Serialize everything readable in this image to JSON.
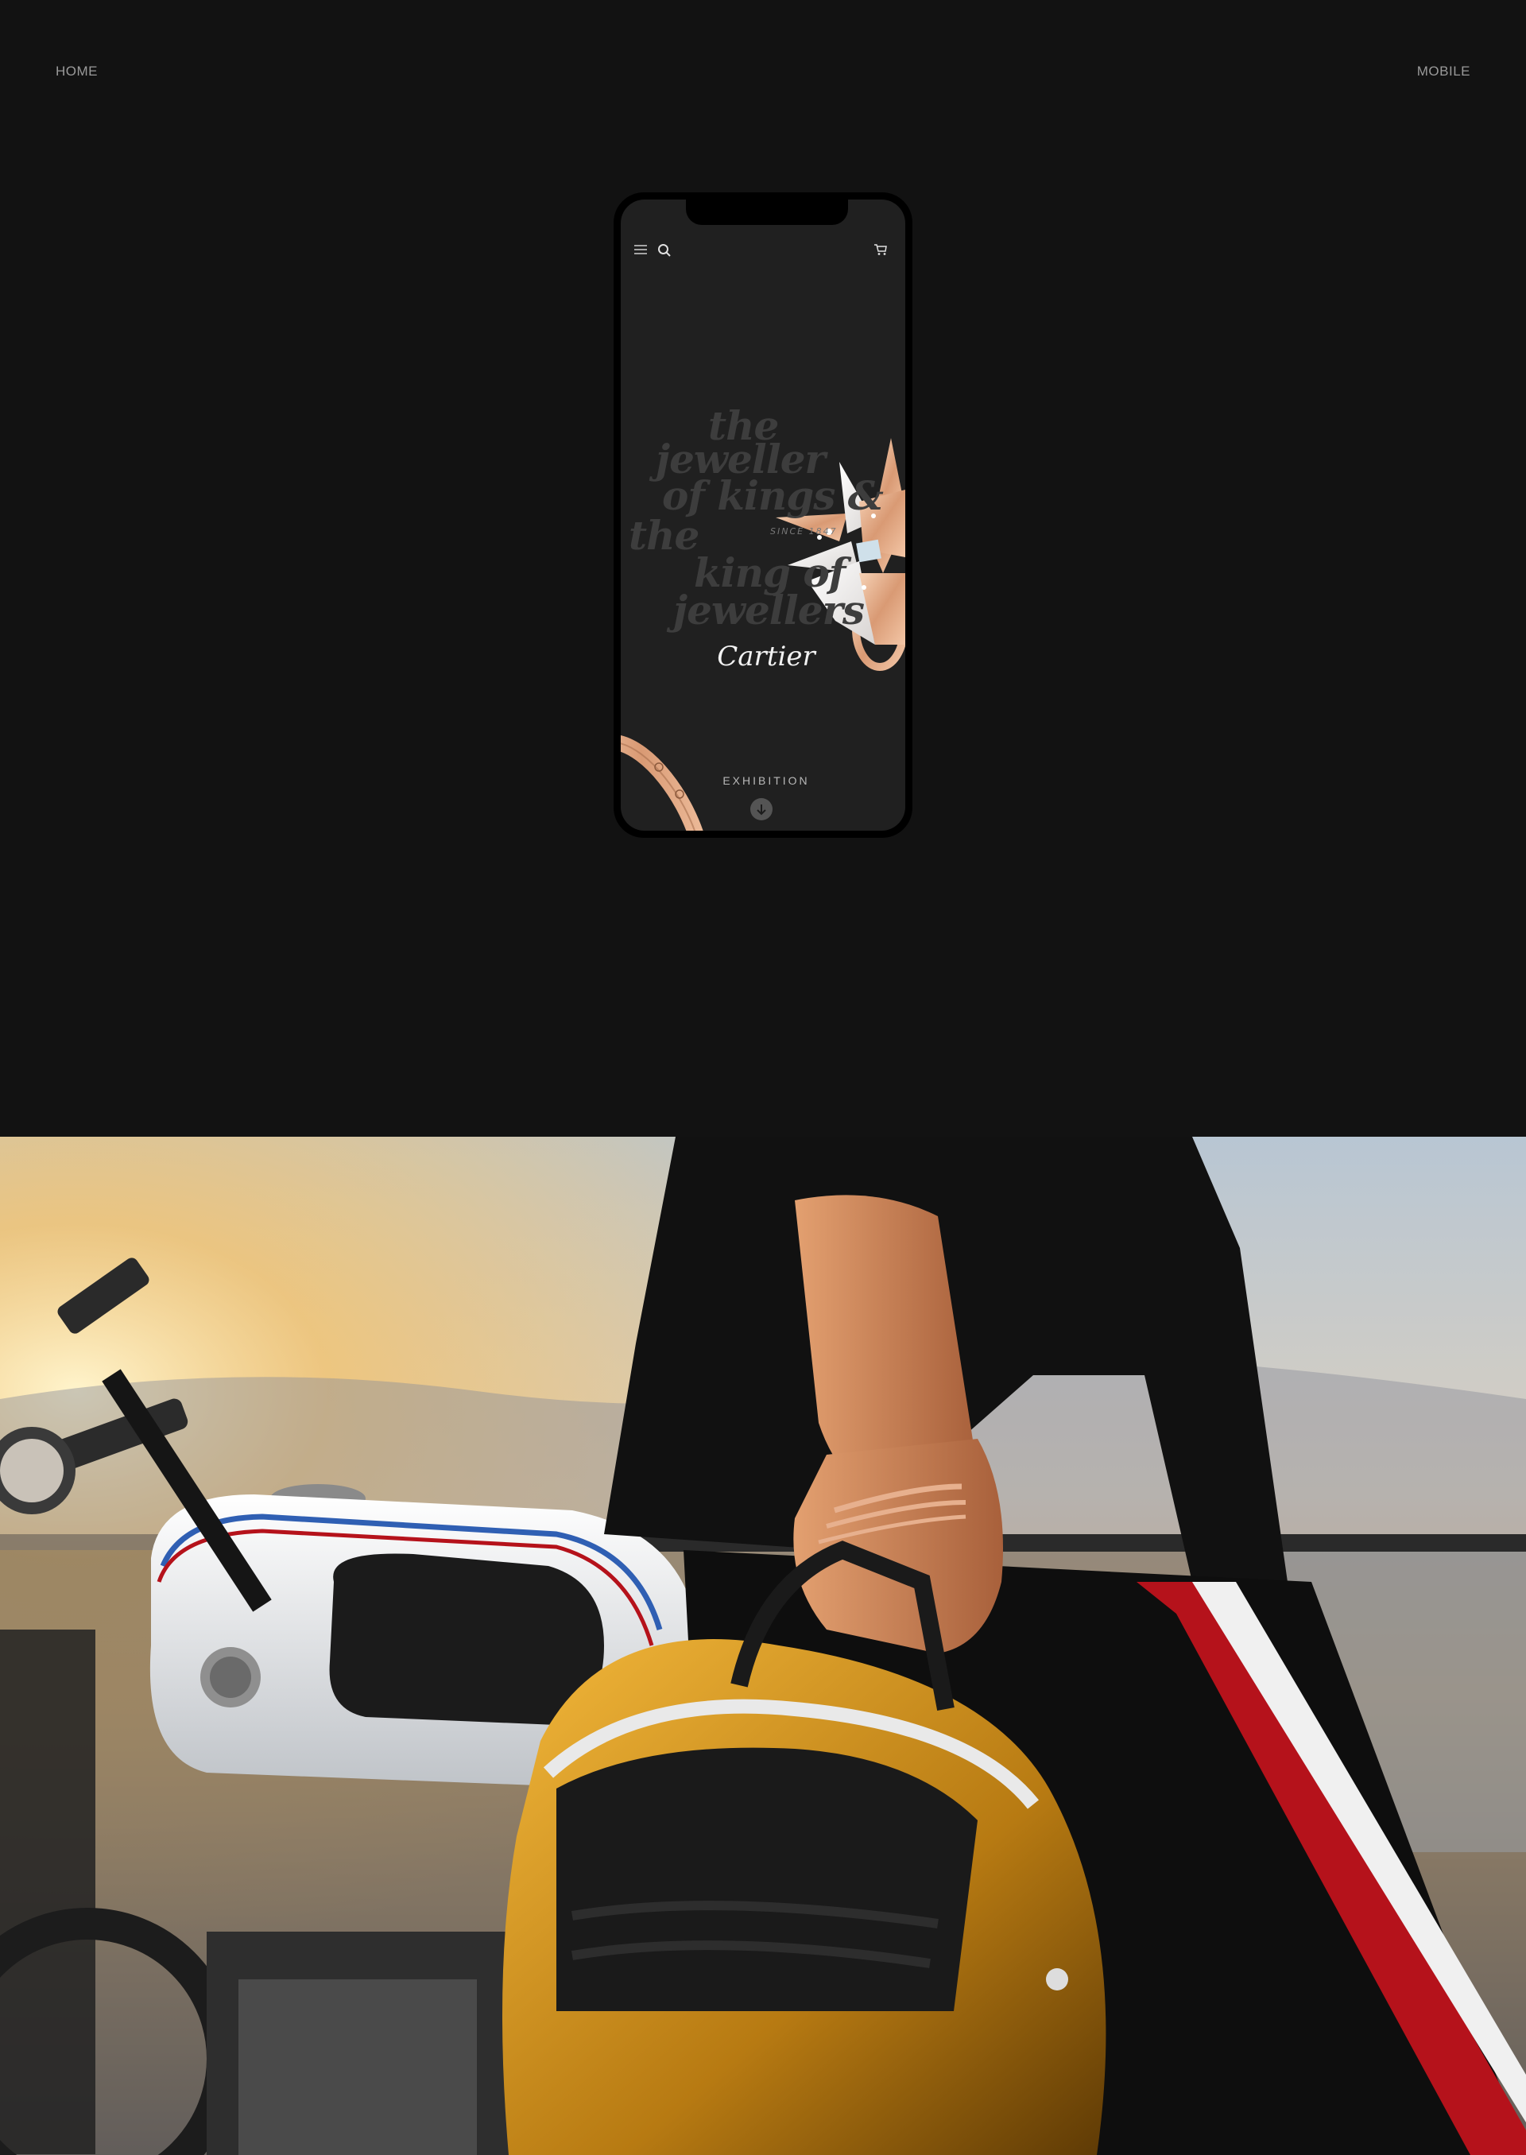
{
  "header": {
    "left_label": "HOME",
    "right_label": "MOBILE"
  },
  "phone": {
    "icons": [
      "menu-icon",
      "search-icon",
      "cart-icon",
      "arrow-down-icon"
    ],
    "tagline": {
      "line1": "the",
      "line2": "jeweller",
      "line3": "of kings",
      "ampersand": "&",
      "line4": "the",
      "line5": "king of",
      "line6": "jewellers"
    },
    "since": "SINCE 1847",
    "brand": "Cartier",
    "cta": "EXHIBITION"
  },
  "colors": {
    "background": "#121212",
    "phone_screen": "#202020",
    "rose_gold": "#e7b08e",
    "accent_red": "#b5121b"
  }
}
